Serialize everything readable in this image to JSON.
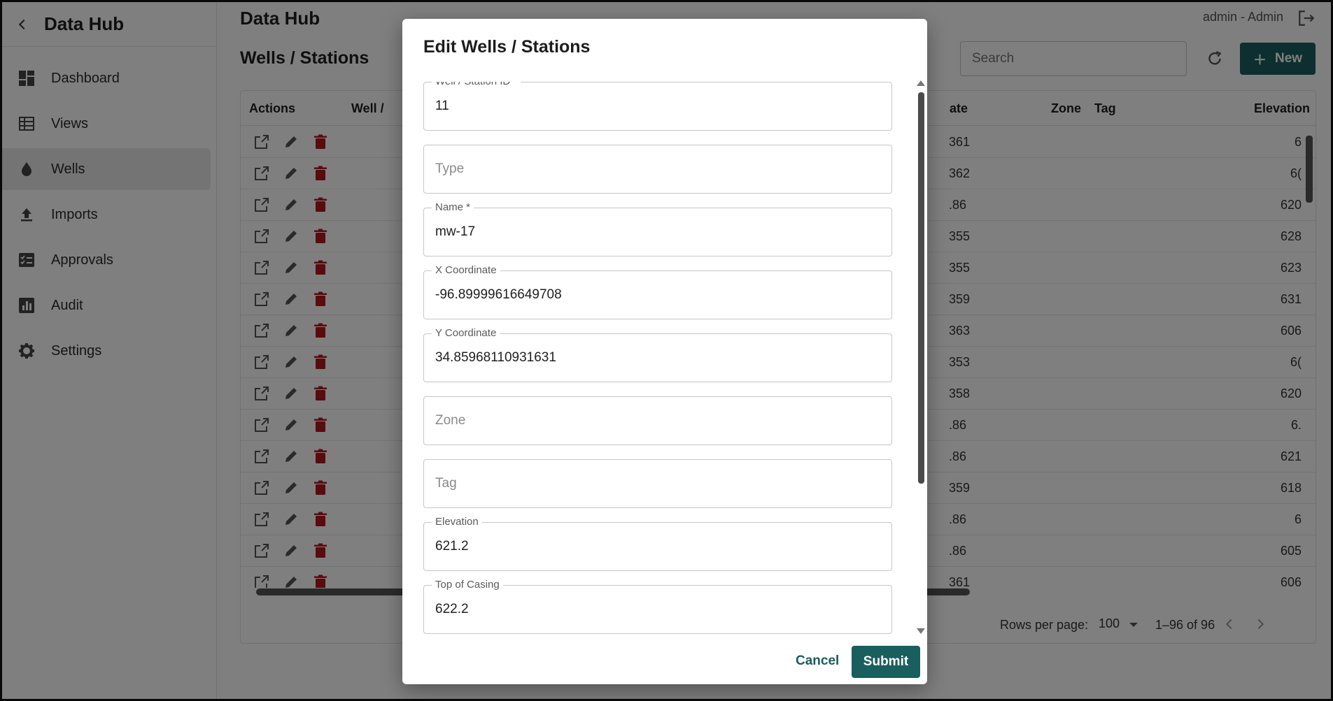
{
  "app": {
    "title": "Data Hub"
  },
  "sidebar": {
    "items": [
      {
        "label": "Dashboard",
        "icon": "dashboard-icon"
      },
      {
        "label": "Views",
        "icon": "table-icon"
      },
      {
        "label": "Wells",
        "icon": "drop-icon",
        "active": true
      },
      {
        "label": "Imports",
        "icon": "upload-icon"
      },
      {
        "label": "Approvals",
        "icon": "checklist-icon"
      },
      {
        "label": "Audit",
        "icon": "bar-chart-icon"
      },
      {
        "label": "Settings",
        "icon": "gear-icon"
      }
    ]
  },
  "header": {
    "title": "Data Hub",
    "user": "admin - Admin"
  },
  "page": {
    "title": "Wells / Stations"
  },
  "search": {
    "placeholder": "Search"
  },
  "toolbar": {
    "new_label": "New"
  },
  "table": {
    "headers": {
      "actions": "Actions",
      "well": "Well /",
      "date": "ate",
      "zone": "Zone",
      "tag": "Tag",
      "elevation": "Elevation"
    },
    "rows": [
      {
        "date": "361",
        "elev": "6"
      },
      {
        "date": "362",
        "elev": "6("
      },
      {
        "date": ".86",
        "elev": "620"
      },
      {
        "date": "355",
        "elev": "628"
      },
      {
        "date": "355",
        "elev": "623"
      },
      {
        "date": "359",
        "elev": "631"
      },
      {
        "date": "363",
        "elev": "606"
      },
      {
        "date": "353",
        "elev": "6("
      },
      {
        "date": "358",
        "elev": "620"
      },
      {
        "date": ".86",
        "elev": "6."
      },
      {
        "date": ".86",
        "elev": "621"
      },
      {
        "date": "359",
        "elev": "618"
      },
      {
        "date": ".86",
        "elev": "6"
      },
      {
        "date": ".86",
        "elev": "605"
      },
      {
        "date": "361",
        "elev": "606"
      }
    ]
  },
  "pagination": {
    "rows_per_page_label": "Rows per page:",
    "rows_per_page": "100",
    "range": "1–96 of 96"
  },
  "modal": {
    "title": "Edit Wells / Stations",
    "fields": [
      {
        "label": "Well / Station ID *",
        "value": "11"
      },
      {
        "label": "",
        "placeholder": "Type",
        "value": ""
      },
      {
        "label": "Name *",
        "value": "mw-17"
      },
      {
        "label": "X Coordinate",
        "value": "-96.89999616649708"
      },
      {
        "label": "Y Coordinate",
        "value": "34.85968110931631"
      },
      {
        "label": "",
        "placeholder": "Zone",
        "value": ""
      },
      {
        "label": "",
        "placeholder": "Tag",
        "value": ""
      },
      {
        "label": "Elevation",
        "value": "621.2"
      },
      {
        "label": "Top of Casing",
        "value": "622.2"
      }
    ],
    "cancel_label": "Cancel",
    "submit_label": "Submit"
  },
  "colors": {
    "primary": "#1a5e5e",
    "delete": "#b3161b"
  }
}
